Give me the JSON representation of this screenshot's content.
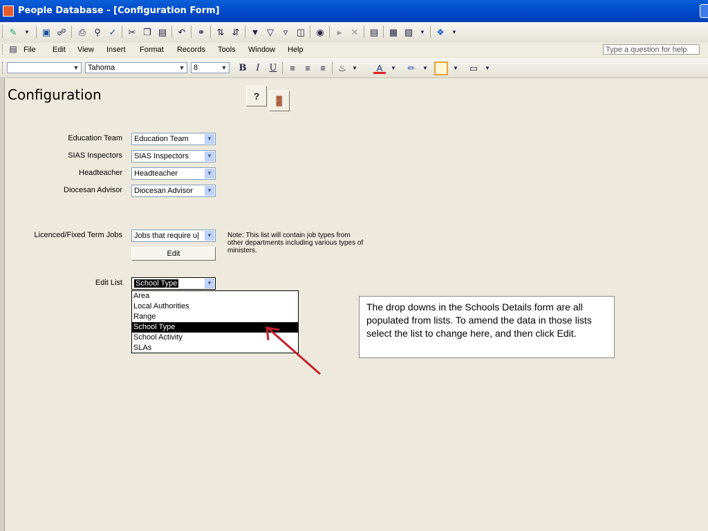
{
  "window": {
    "title": "People Database - [Configuration Form]"
  },
  "menu": [
    "File",
    "Edit",
    "View",
    "Insert",
    "Format",
    "Records",
    "Tools",
    "Window",
    "Help"
  ],
  "help_placeholder": "Type a question for help",
  "format_bar": {
    "object": "",
    "font": "Tahoma",
    "size": "8",
    "bold": "B",
    "italic": "I",
    "underline": "U"
  },
  "form": {
    "title": "Configuration",
    "help_icon": "?",
    "exit_icon": "exit-door",
    "fields": [
      {
        "label": "Education Team",
        "value": "Education Team"
      },
      {
        "label": "SIAS Inspectors",
        "value": "SIAS Inspectors"
      },
      {
        "label": "Headteacher",
        "value": "Headteacher"
      },
      {
        "label": "Diocesan Advisor",
        "value": "Diocesan Advisor"
      }
    ],
    "jobs": {
      "label": "Licenced/Fixed Term Jobs",
      "value": "Jobs that require u|",
      "edit_label": "Edit",
      "note": "Note: This list will contain job types from other departments including various types of ministers."
    },
    "edit_list": {
      "label": "Edit List",
      "value": "School Type",
      "options": [
        "Area",
        "Local Authorities",
        "Range",
        "School Type",
        "School Activity",
        "SLAs"
      ],
      "selected_index": 3
    }
  },
  "callout": "The drop downs in the Schools Details form are all populated from lists.  To amend the data in those lists select the list to change here, and then click Edit.",
  "colors": {
    "titlebar": "#0046C7",
    "form_bg": "#EDE9DC",
    "arrow": "#C0202A",
    "selection": "#000000"
  }
}
